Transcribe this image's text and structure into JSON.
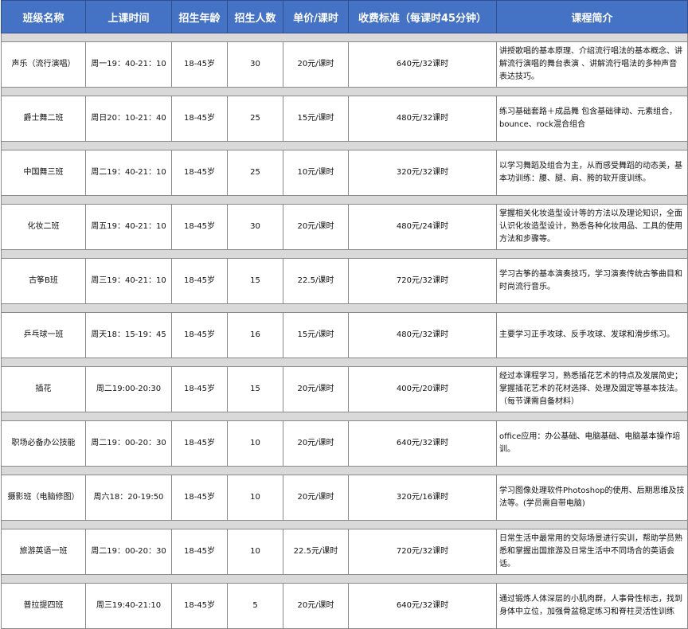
{
  "headers": [
    "班级名称",
    "上课时间",
    "招生年龄",
    "招生人数",
    "单价/课时",
    "收费标准（每课时45分钟）",
    "课程简介"
  ],
  "rows": [
    {
      "name": "声乐（流行演唱）",
      "time": "周一19：40-21：10",
      "age": "18-45岁",
      "count": "30",
      "price": "20元/课时",
      "fee": "640元/32课时",
      "intro": "讲授歌唱的基本原理、介绍流行唱法的基本概念、讲解流行演唱的舞台表演 、讲解流行唱法的多种声音表达技巧。"
    },
    {
      "name": "爵士舞二班",
      "time": "周日20：10-21：40",
      "age": "18-45岁",
      "count": "25",
      "price": "15元/课时",
      "fee": "480元/32课时",
      "intro": "练习基础套路＋成品舞 包含基础律动、元素组合，bounce、rock混合组合"
    },
    {
      "name": "中国舞三班",
      "time": "周二19：40-21：10",
      "age": "18-45岁",
      "count": "25",
      "price": "10元/课时",
      "fee": "320元/32课时",
      "intro": "以学习舞蹈及组合为主，从而感受舞蹈的动态美，基本功训练：腰、腿、肩、胯的软开度训练。"
    },
    {
      "name": "化妆二班",
      "time": "周五19：40-21：10",
      "age": "18-45岁",
      "count": "30",
      "price": "20元/课时",
      "fee": "480元/24课时",
      "intro": "掌握相关化妆造型设计等的方法以及理论知识，全面认识化妆造型设计，熟悉各种化妆用品、工具的使用方法和步骤等。"
    },
    {
      "name": "古筝B班",
      "time": "周三19：40-21：10",
      "age": "18-45岁",
      "count": "15",
      "price": "22.5/课时",
      "fee": "720元/32课时",
      "intro": "学习古筝的基本演奏技巧，学习演奏传统古筝曲目和时尚流行音乐。"
    },
    {
      "name": "乒乓球一班",
      "time": "周天18：15-19：45",
      "age": "18-45岁",
      "count": "16",
      "price": "15元/课时",
      "fee": "480元/32课时",
      "intro": "主要学习正手攻球、反手攻球、发球和滑步练习。"
    },
    {
      "name": "插花",
      "time": "周二19:00-20:30",
      "age": "18-45岁",
      "count": "15",
      "price": "20元/课时",
      "fee": "400元/20课时",
      "intro": "经过本课程学习，熟悉插花艺术的特点及发展简史；掌握插花艺术的花材选择、处理及固定等基本技法。（每节课需自备材料）"
    },
    {
      "name": "职场必备办公技能",
      "time": "周二19：00-20：30",
      "age": "18-45岁",
      "count": "10",
      "price": "20元/课时",
      "fee": "640元/32课时",
      "intro": "office应用：办公基础、电脑基础、电脑基本操作培训。"
    },
    {
      "name": "摄影班（电脑修图）",
      "time": "周六18：20-19:50",
      "age": "18-45岁",
      "count": "10",
      "price": "20元/课时",
      "fee": "320元/16课时",
      "intro": "学习图像处理软件Photoshop的使用、后期思维及技法等。(学员需自带电脑)"
    },
    {
      "name": "旅游英语一班",
      "time": "周二19：00-20：30",
      "age": "18-45岁",
      "count": "10",
      "price": "22.5元/课时",
      "fee": "720元/32课时",
      "intro": "日常生活中最常用的交际场景进行实训，帮助学员熟悉和掌握出国旅游及日常生活中不同场合的英语会话。"
    },
    {
      "name": "普拉提四班",
      "time": "周三19:40-21:10",
      "age": "18-45岁",
      "count": "5",
      "price": "20元/课时",
      "fee": "640元/32课时",
      "intro": "通过锻炼人体深层的小肌肉群，人事骨性标志，找到身体中立位，加强骨盆稳定练习和脊柱灵活性训练"
    }
  ]
}
